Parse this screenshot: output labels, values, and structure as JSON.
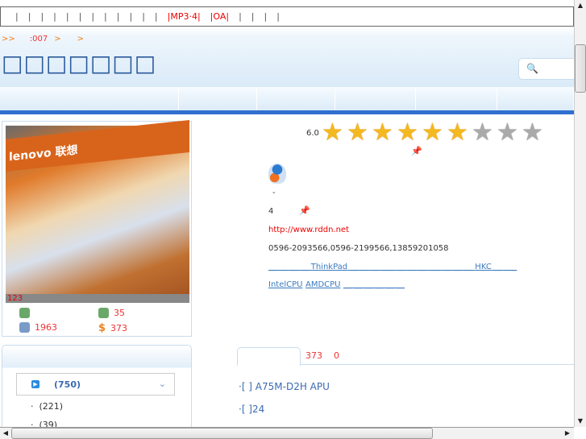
{
  "topbar": {
    "items": [
      "|",
      "|",
      "|",
      "|",
      "|",
      "|",
      "|",
      "|",
      "|",
      "|",
      "|",
      "|",
      "|MP3·4|",
      "|OA|",
      "|",
      "|",
      "|",
      "|"
    ]
  },
  "breadcrumb": {
    "a": ">>",
    "b": ":007",
    ">1": ">",
    "c": ">"
  },
  "shop_title": "□□□□□□□",
  "search": {
    "icon": "search-icon"
  },
  "photo": {
    "sign": "lenovo 联想",
    "caption": "123"
  },
  "stats": {
    "s1": "",
    "s2": "35",
    "s3": "1963",
    "s4": "373"
  },
  "categories": {
    "main": "(750)",
    "subs": [
      "(221)",
      "(39)"
    ]
  },
  "rating": {
    "score": "6.0",
    "value": 6,
    "max": 9
  },
  "info": {
    "dash": "-",
    "level": "4",
    "url": "http://www.rddn.net",
    "phone": "0596-2093566,0596-2199566,13859201058",
    "links1": [
      "ThinkPad",
      "HKC"
    ],
    "links2": [
      "IntelCPU",
      "AMDCPU"
    ]
  },
  "tabs": {
    "count1": "373",
    "count2": "0"
  },
  "list": [
    "·[ ]  A75M-D2H APU",
    "·[ ]24"
  ],
  "colors": {
    "accent": "#2f6fd0",
    "red": "#ee2222"
  }
}
